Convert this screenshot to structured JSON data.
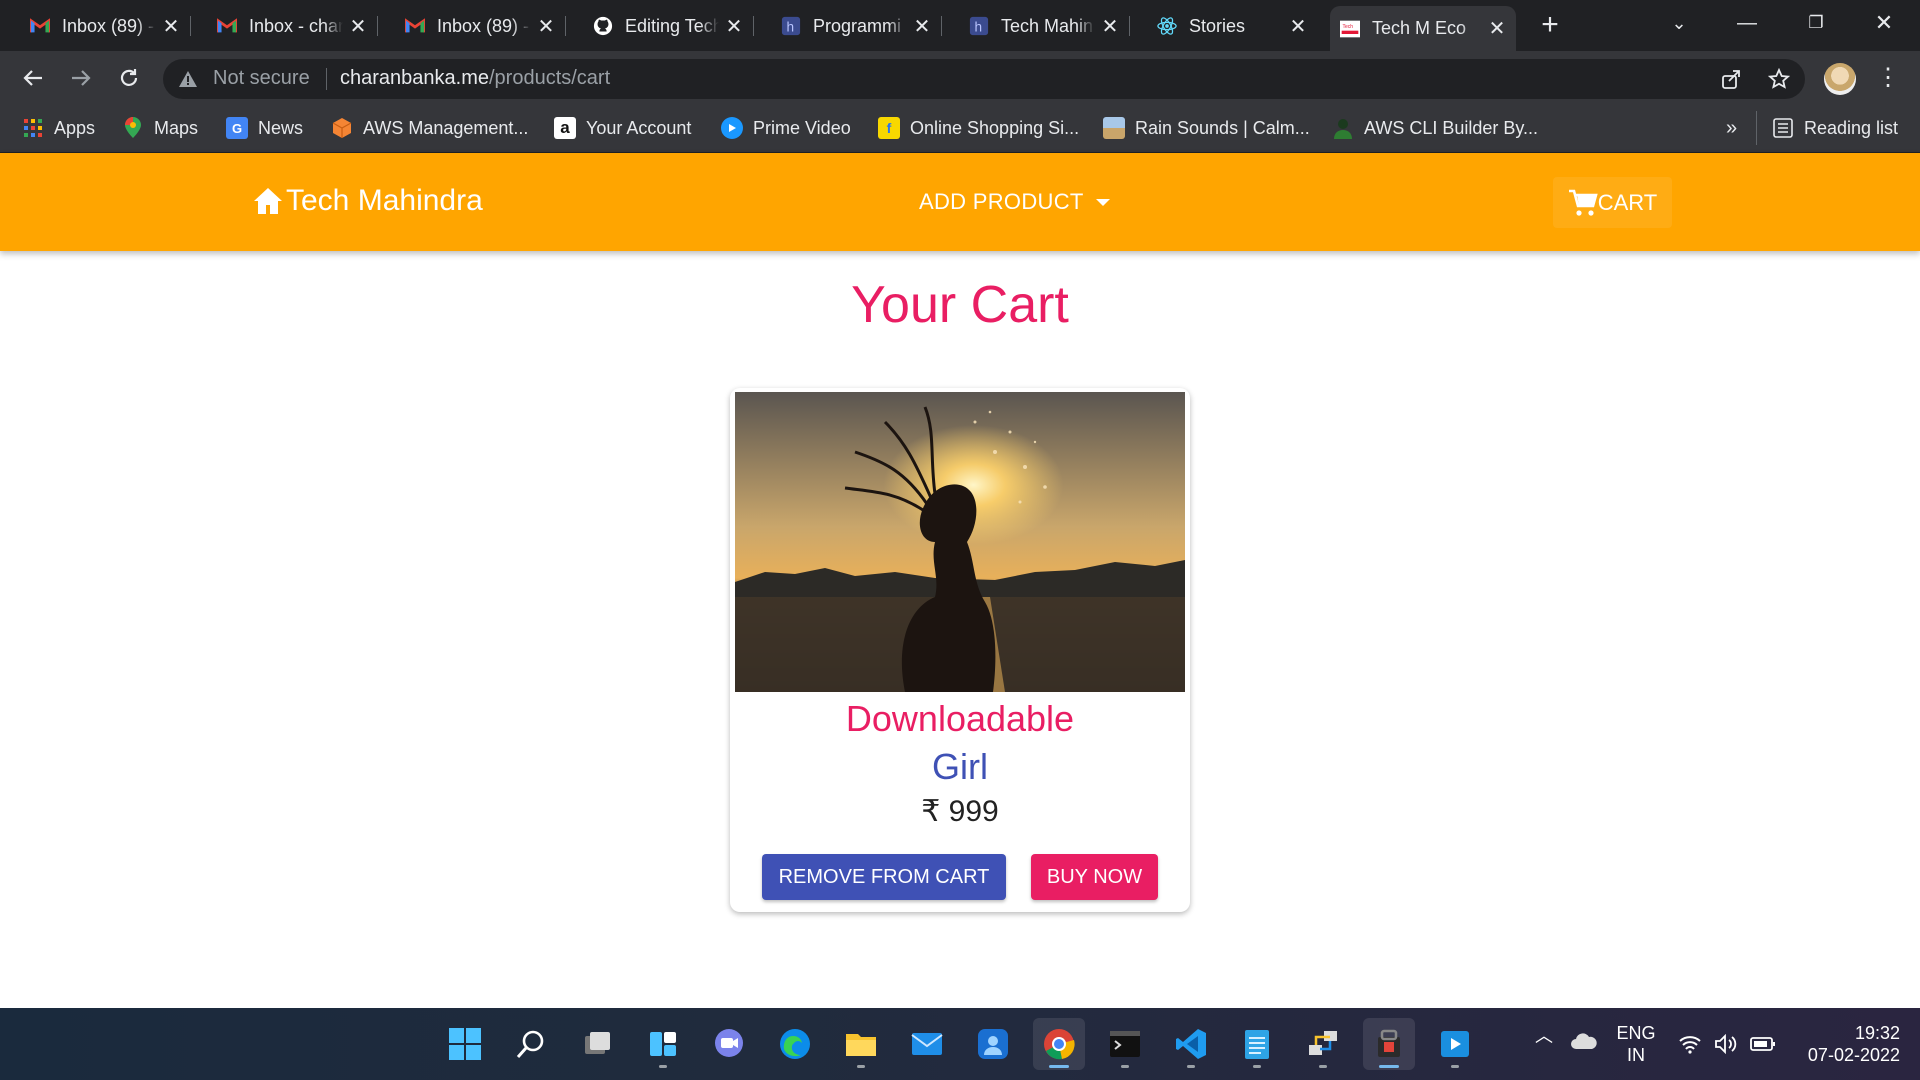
{
  "browser": {
    "tabs": [
      {
        "title": "Inbox (89) -",
        "icon": "gmail-icon",
        "active": false
      },
      {
        "title": "Inbox - char",
        "icon": "gmail-icon",
        "active": false
      },
      {
        "title": "Inbox (89) -",
        "icon": "gmail-icon",
        "active": false
      },
      {
        "title": "Editing Tech",
        "icon": "github-icon",
        "active": false
      },
      {
        "title": "Programmi",
        "icon": "hashnode-icon",
        "active": false
      },
      {
        "title": "Tech Mahin",
        "icon": "hashnode-icon",
        "active": false
      },
      {
        "title": "Stories",
        "icon": "react-icon",
        "active": false
      },
      {
        "title": "Tech M Eco",
        "icon": "techm-icon",
        "active": true
      }
    ],
    "address": {
      "security_label": "Not secure",
      "domain": "charanbanka.me",
      "path": "/products/cart"
    },
    "bookmarks": [
      {
        "label": "Apps",
        "icon": "apps-grid-icon",
        "color": "#ea4335"
      },
      {
        "label": "Maps",
        "icon": "maps-pin-icon",
        "color": "#34a853"
      },
      {
        "label": "News",
        "icon": "google-news-icon",
        "color": "#4285f4"
      },
      {
        "label": "AWS Management...",
        "icon": "aws-cube-icon",
        "color": "#f58534"
      },
      {
        "label": "Your Account",
        "icon": "amazon-icon",
        "color": "#ffffff"
      },
      {
        "label": "Prime Video",
        "icon": "prime-video-icon",
        "color": "#1a98ff"
      },
      {
        "label": "Online Shopping Si...",
        "icon": "flipkart-icon",
        "color": "#f8d800"
      },
      {
        "label": "Rain Sounds | Calm...",
        "icon": "landscape-icon",
        "color": "#a8c8e8"
      },
      {
        "label": "AWS CLI Builder By...",
        "icon": "person-icon",
        "color": "#2e7d32"
      }
    ],
    "more_bookmarks": "»",
    "reading_list": "Reading list"
  },
  "app": {
    "brand": "Tech Mahindra",
    "nav_add_product": "ADD PRODUCT",
    "nav_cart": "CART",
    "accent_color": "#ffa500"
  },
  "cart": {
    "title": "Your Cart",
    "items": [
      {
        "name": "Downloadable",
        "subtitle": "Girl",
        "price": "₹ 999",
        "image": "sunset-girl-splash-photo",
        "remove_label": "REMOVE FROM CART",
        "buy_label": "BUY NOW"
      }
    ]
  },
  "taskbar": {
    "apps": [
      "windows-start-icon",
      "search-icon",
      "task-view-icon",
      "widgets-icon",
      "chat-icon",
      "edge-icon",
      "file-explorer-icon",
      "mail-icon",
      "store-icon",
      "chrome-icon",
      "terminal-icon",
      "vscode-icon",
      "notepad-icon",
      "network-icon",
      "app-icon",
      "media-player-icon"
    ],
    "language": "ENG",
    "region": "IN",
    "time": "19:32",
    "date": "07-02-2022"
  }
}
